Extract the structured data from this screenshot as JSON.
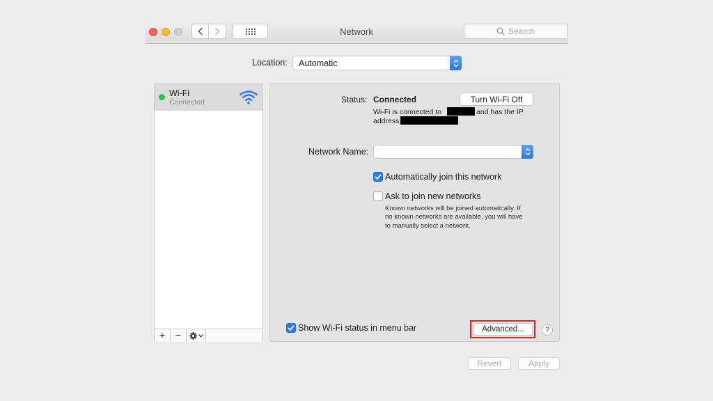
{
  "window": {
    "title": "Network",
    "search_placeholder": "Search"
  },
  "location": {
    "label": "Location:",
    "value": "Automatic"
  },
  "services": [
    {
      "name": "Wi-Fi",
      "status": "Connected",
      "status_color": "#28c840"
    }
  ],
  "list_controls": {
    "add": "+",
    "remove": "−"
  },
  "details": {
    "status_label": "Status:",
    "status_value": "Connected",
    "turn_off_button": "Turn Wi-Fi Off",
    "status_line1_prefix": "Wi-Fi is connected to",
    "status_line1_suffix": "and has the IP",
    "status_line2_prefix": "address",
    "status_line2_suffix": ".",
    "network_name_label": "Network Name:",
    "network_name_value": "",
    "auto_join_label": "Automatically join this network",
    "auto_join_checked": true,
    "ask_join_label": "Ask to join new networks",
    "ask_join_checked": false,
    "ask_join_help_1": "Known networks will be joined automatically. If",
    "ask_join_help_2": "no known networks are available, you will have",
    "ask_join_help_3": "to manually select a network.",
    "show_status_label": "Show Wi-Fi status in menu bar",
    "show_status_checked": true,
    "advanced_button": "Advanced...",
    "help_button": "?"
  },
  "footer": {
    "revert": "Revert",
    "apply": "Apply"
  },
  "colors": {
    "accent": "#2c7cf1",
    "highlight_box": "#d9261c",
    "close": "#fe5f57",
    "minimize": "#febc2e",
    "zoom": "#cfcfcf"
  }
}
